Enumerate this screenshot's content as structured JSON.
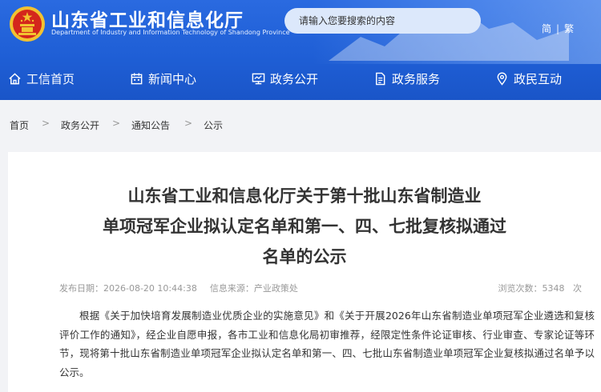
{
  "header": {
    "site_title": "山东省工业和信息化厅",
    "site_subtitle": "Department of Industry and Information Technology of Shandong Province",
    "search_placeholder": "请输入您要搜索的内容",
    "lang_simplified": "简",
    "lang_separator": "|",
    "lang_traditional": "繁"
  },
  "nav": {
    "items": [
      {
        "label": "工信首页",
        "icon": "home-icon"
      },
      {
        "label": "新闻中心",
        "icon": "calendar-icon"
      },
      {
        "label": "政务公开",
        "icon": "monitor-icon"
      },
      {
        "label": "政务服务",
        "icon": "document-icon"
      },
      {
        "label": "政民互动",
        "icon": "location-icon"
      }
    ]
  },
  "breadcrumb": {
    "items": [
      "首页",
      "政务公开",
      "通知公告",
      "公示"
    ],
    "separator": ">"
  },
  "article": {
    "title_lines": [
      "山东省工业和信息化厅关于第十批山东省制造业",
      "单项冠军企业拟认定名单和第一、四、七批复核拟通过",
      "名单的公示"
    ],
    "publish_label": "发布日期：",
    "publish_time": "2026-08-20 10:44:38",
    "source_label": "信息来源：",
    "source": "产业政策处",
    "views_label": "浏览次数：",
    "views": "5348",
    "views_unit": "次",
    "body": "根据《关于加快培育发展制造业优质企业的实施意见》和《关于开展2026年山东省制造业单项冠军企业遴选和复核评价工作的通知》，经企业自愿申报，各市工业和信息化局初审推荐，经限定性条件论证审核、行业审查、专家论证等环节，现将第十批山东省制造业单项冠军企业拟认定名单和第一、四、七批山东省制造业单项冠军企业复核拟通过名单予以公示。"
  },
  "colors": {
    "header_blue": "#1f5fd6",
    "emblem_red": "#d4261c",
    "emblem_gold": "#f2c230"
  }
}
